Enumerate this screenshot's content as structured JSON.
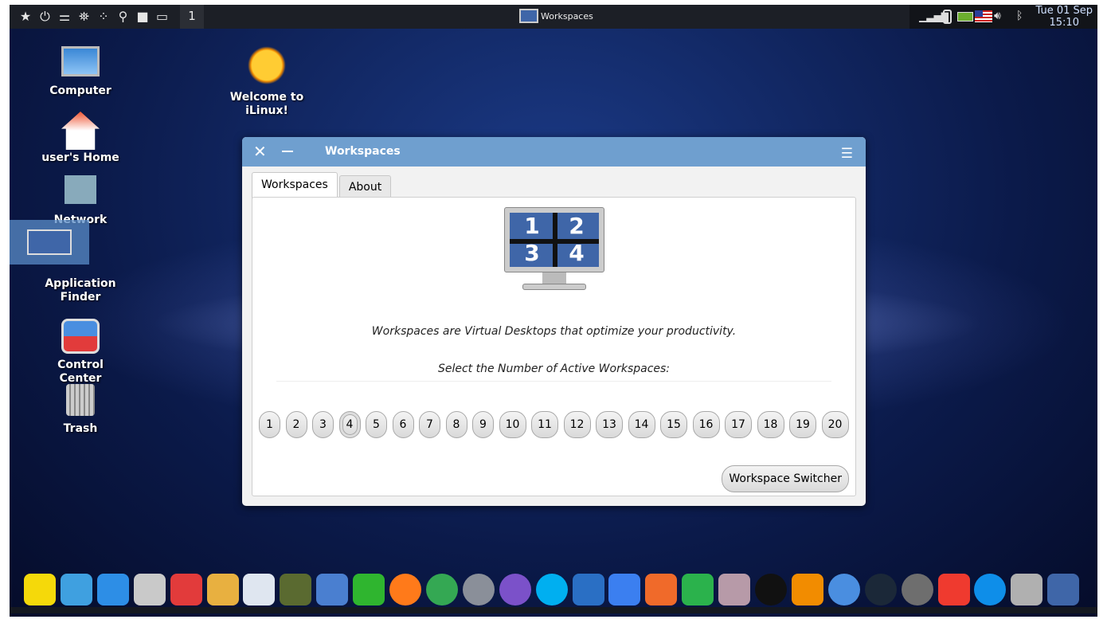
{
  "topbar": {
    "workspace_number": "1",
    "task_title": "Workspaces",
    "date": "Tue 01 Sep",
    "time": "15:10",
    "left_icons": [
      "star-icon",
      "power-icon",
      "toggle-icon",
      "binoculars-icon",
      "apps-dots-icon",
      "search-icon",
      "folder-icon",
      "desktop-icon"
    ],
    "tray_icons": [
      "signal-icon",
      "battery-device-icon",
      "battery-charging-icon",
      "us-flag-icon",
      "volume-icon",
      "bluetooth-icon"
    ]
  },
  "desktop": {
    "icons": [
      {
        "label": "Computer"
      },
      {
        "label": "user's Home"
      },
      {
        "label": "Network"
      },
      {
        "label": "Application Finder"
      },
      {
        "label": "Control Center"
      },
      {
        "label": "Trash"
      },
      {
        "label": "Welcome to iLinux!"
      }
    ]
  },
  "window": {
    "title": "Workspaces",
    "tabs": [
      {
        "label": "Workspaces",
        "active": true
      },
      {
        "label": "About",
        "active": false
      }
    ],
    "description": "Workspaces are Virtual Desktops that optimize your productivity.",
    "prompt": "Select the Number of Active Workspaces:",
    "numbers": [
      "1",
      "2",
      "3",
      "4",
      "5",
      "6",
      "7",
      "8",
      "9",
      "10",
      "11",
      "12",
      "13",
      "14",
      "15",
      "16",
      "17",
      "18",
      "19",
      "20"
    ],
    "selected": "4",
    "switcher_label": "Workspace Switcher",
    "logo_digits": [
      "1",
      "2",
      "3",
      "4"
    ]
  },
  "dock": {
    "items": [
      {
        "icon": "favorites-star-icon",
        "color": "#f5d90a"
      },
      {
        "icon": "app-launcher-icon",
        "color": "#3fa0e0"
      },
      {
        "icon": "window-icon",
        "color": "#2d8ee6"
      },
      {
        "icon": "file-cabinet-icon",
        "color": "#c9c9c9"
      },
      {
        "icon": "control-center-icon",
        "color": "#e23b3b"
      },
      {
        "icon": "color-palette-icon",
        "color": "#e8b040"
      },
      {
        "icon": "app-store-icon",
        "color": "#dfe6f0"
      },
      {
        "icon": "binoculars-icon",
        "color": "#5a6a30"
      },
      {
        "icon": "rocket-icon",
        "color": "#4a7fd0"
      },
      {
        "icon": "green-pipe-icon",
        "color": "#2fb52f"
      },
      {
        "icon": "firefox-icon",
        "color": "#ff7a1a"
      },
      {
        "icon": "chrome-icon",
        "color": "#34a853"
      },
      {
        "icon": "google-earth-pro-icon",
        "color": "#8a8f99"
      },
      {
        "icon": "viber-icon",
        "color": "#7b51c9"
      },
      {
        "icon": "skype-icon",
        "color": "#00aff0"
      },
      {
        "icon": "mail-icon",
        "color": "#2a6fc4"
      },
      {
        "icon": "wps-writer-icon",
        "color": "#3b7ff0"
      },
      {
        "icon": "wps-presentation-icon",
        "color": "#f06a2a"
      },
      {
        "icon": "wps-spreadsheet-icon",
        "color": "#2bb24c"
      },
      {
        "icon": "screenshot-icon",
        "color": "#b79aa8"
      },
      {
        "icon": "amazon-icon",
        "color": "#111111"
      },
      {
        "icon": "vlc-icon",
        "color": "#f28c00"
      },
      {
        "icon": "qbittorrent-icon",
        "color": "#4a8ee0"
      },
      {
        "icon": "steam-icon",
        "color": "#1b2838"
      },
      {
        "icon": "timeshift-icon",
        "color": "#6e6e6e"
      },
      {
        "icon": "anydesk-icon",
        "color": "#ef3a2f"
      },
      {
        "icon": "teamviewer-icon",
        "color": "#0e8ee9"
      },
      {
        "icon": "trash-icon",
        "color": "#b0b0b0"
      },
      {
        "icon": "workspaces-icon",
        "color": "#3f66a8"
      }
    ]
  }
}
